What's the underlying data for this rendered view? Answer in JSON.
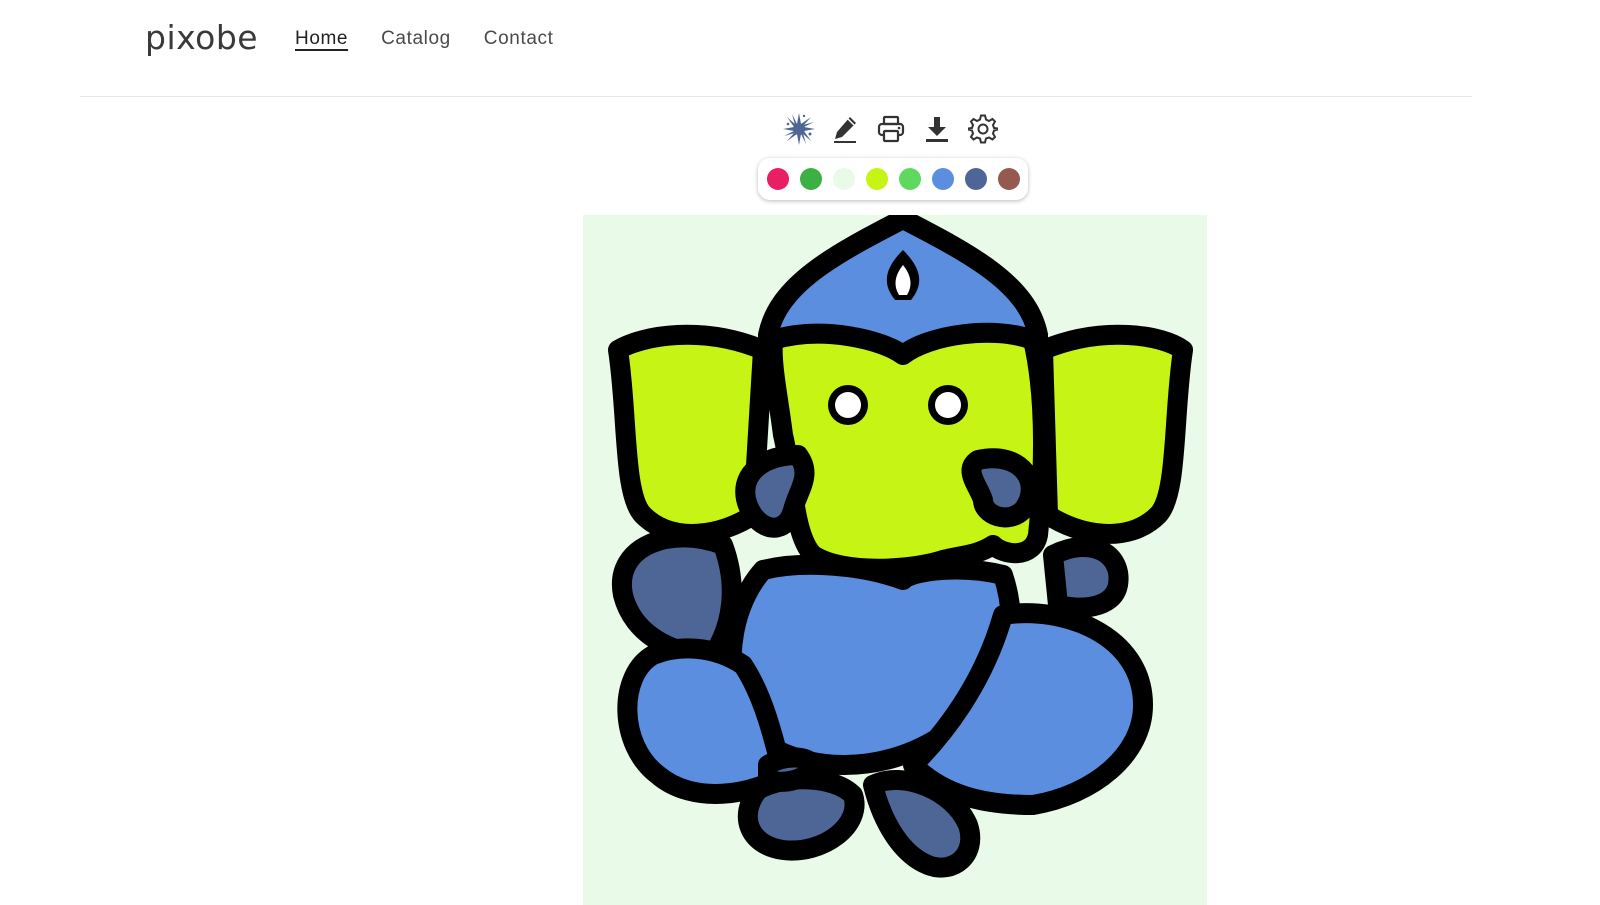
{
  "header": {
    "logo": "pixobe",
    "nav": [
      {
        "label": "Home",
        "active": true
      },
      {
        "label": "Catalog",
        "active": false
      },
      {
        "label": "Contact",
        "active": false
      }
    ]
  },
  "toolbar": {
    "tools": [
      "splash-icon",
      "pencil-icon",
      "print-icon",
      "download-icon",
      "gear-icon"
    ]
  },
  "palette": {
    "colors": [
      "#e91e63",
      "#3cb043",
      "#e9fae9",
      "#c6f414",
      "#5ed95e",
      "#5b8ede",
      "#4e6696",
      "#945a50"
    ]
  },
  "drawing": {
    "background": "#e9fae9",
    "fills": {
      "head": "#c6f414",
      "crown": "#5b8ede",
      "body": "#5b8ede",
      "limbs": "#4e6696",
      "outline": "#000000",
      "eyes": "#ffffff"
    }
  }
}
